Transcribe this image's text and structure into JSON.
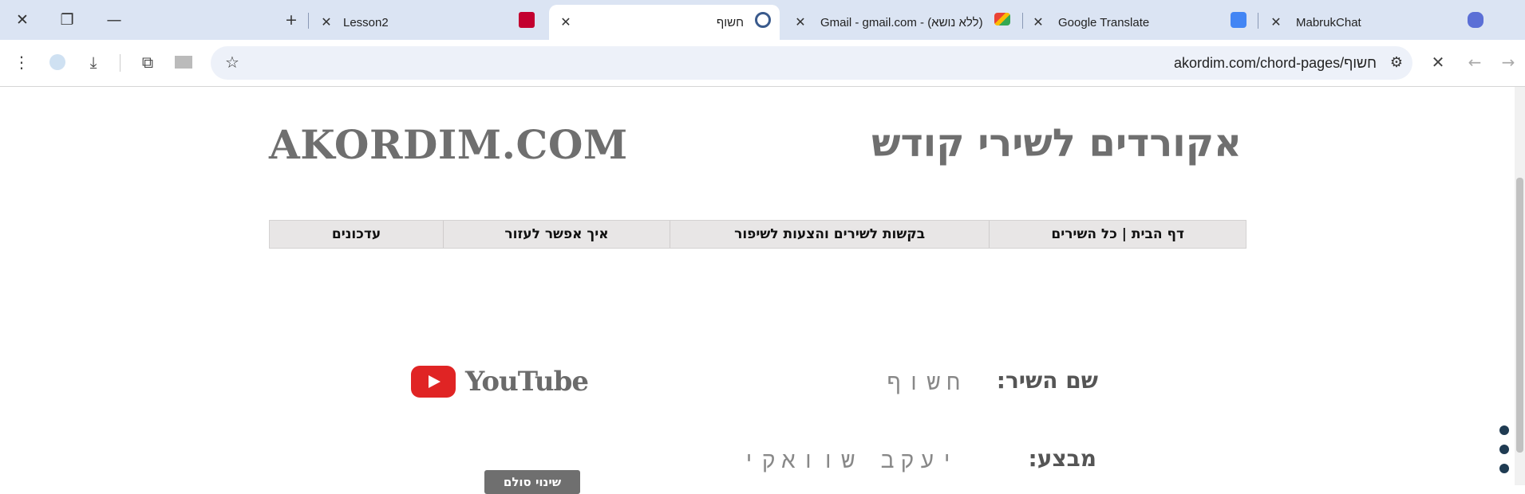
{
  "browser": {
    "tabs": [
      {
        "title": "MabrukChat",
        "icon": "robot-icon"
      },
      {
        "title": "Google Translate",
        "icon": "translate-icon"
      },
      {
        "title": "(ללא נושא) - Gmail - gmail.com",
        "icon": "gmail-icon"
      },
      {
        "title": "חשוף",
        "icon": "akordim-icon",
        "active": true
      },
      {
        "title": "Lesson2",
        "icon": "angular-icon"
      }
    ],
    "url": "akordim.com/chord-pages/חשוף"
  },
  "site": {
    "logo_en": "AKORDIM.COM",
    "logo_he": "אקורדים לשירי קודש",
    "nav": [
      "דף הבית | כל השירים",
      "בקשות לשירים והצעות לשיפור",
      "איך אפשר לעזור",
      "עדכונים"
    ],
    "song_name_label": "שם השיר:",
    "song_name_value": "חשוף",
    "performer_label": "מבצע:",
    "performer_value": "יעקב שוואקי",
    "youtube_label": "YouTube",
    "grey_button": "שינוי סולם"
  }
}
